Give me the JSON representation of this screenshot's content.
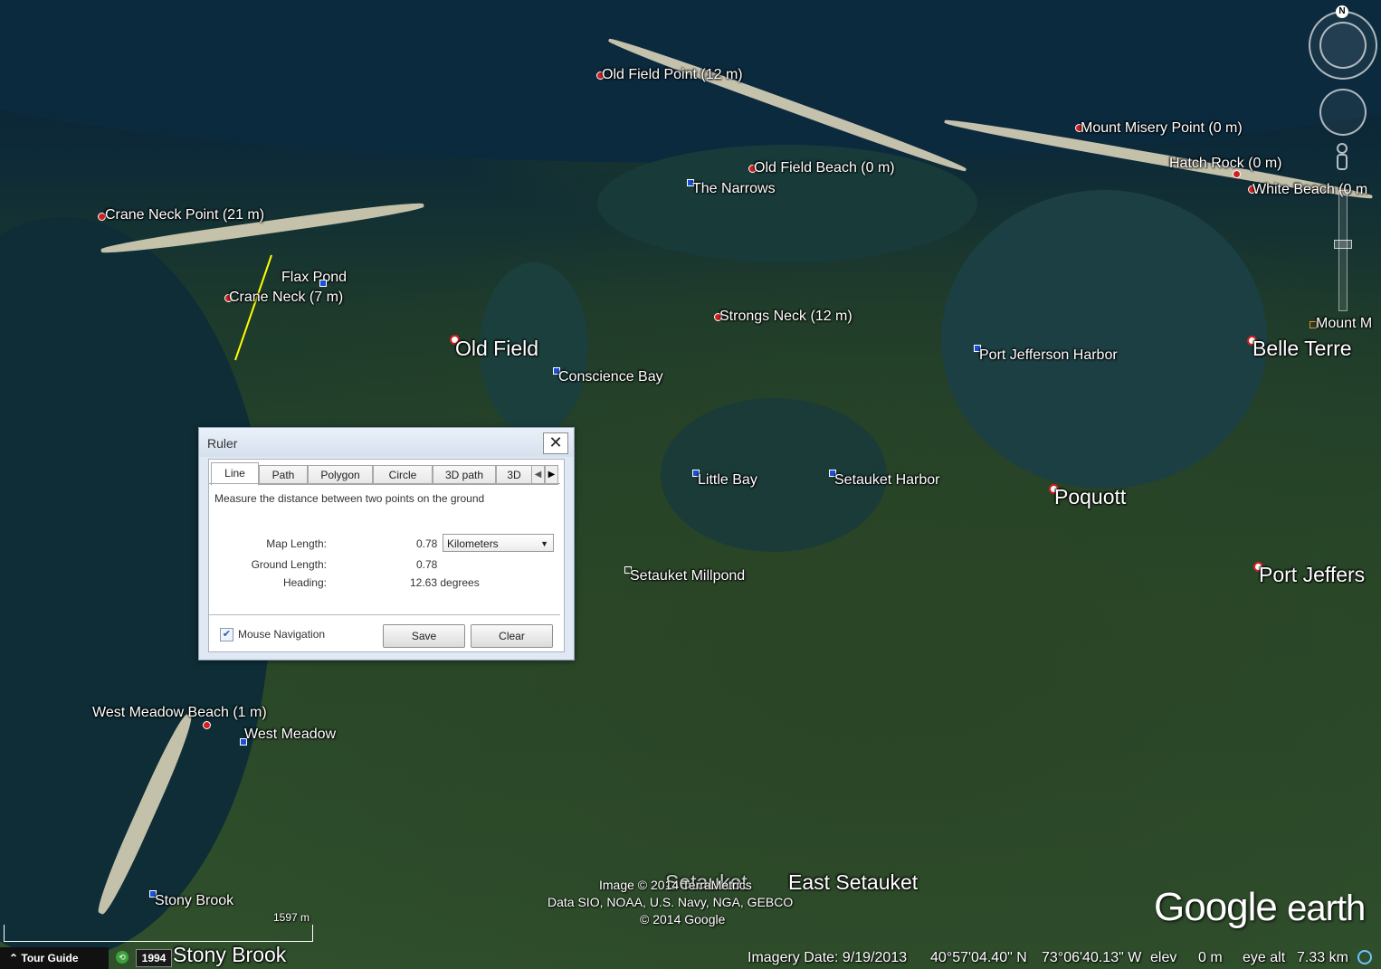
{
  "ruler": {
    "title": "Ruler",
    "close": "✕",
    "tabs": [
      "Line",
      "Path",
      "Polygon",
      "Circle",
      "3D path",
      "3D"
    ],
    "description": "Measure the distance between two points on the ground",
    "map_length_label": "Map Length:",
    "map_length_value": "0.78",
    "unit": "Kilometers",
    "ground_length_label": "Ground Length:",
    "ground_length_value": "0.78",
    "heading_label": "Heading:",
    "heading_value": "12.63 degrees",
    "mouse_nav_label": "Mouse Navigation",
    "mouse_nav_checked": true,
    "save_label": "Save",
    "clear_label": "Clear"
  },
  "places": {
    "old_field_point": "Old Field Point (12 m)",
    "mount_misery_point": "Mount Misery Point (0 m)",
    "hatch_rock": "Hatch Rock (0 m)",
    "white_beach": "White Beach (0 m",
    "old_field_beach": "Old Field Beach (0 m)",
    "the_narrows": "The Narrows",
    "crane_neck_point": "Crane Neck Point (21 m)",
    "flax_pond": "Flax Pond",
    "crane_neck": "Crane Neck (7 m)",
    "strongs_neck": "Strongs Neck (12 m)",
    "old_field": "Old Field",
    "conscience_bay": "Conscience Bay",
    "port_jefferson_harbor": "Port Jefferson Harbor",
    "mount_m": "Mount M",
    "belle_terre": "Belle Terre",
    "little_bay": "Little Bay",
    "setauket_harbor": "Setauket Harbor",
    "poquott": "Poquott",
    "port_jefferson": "Port Jeffers",
    "setauket_millpond": "Setauket Millpond",
    "west_meadow_beach": "West Meadow Beach (1 m)",
    "west_meadow": "West Meadow",
    "stony_brook_small": "Stony Brook",
    "stony_brook_large": "Stony Brook",
    "setauket": "Setauket",
    "east_setauket": "East Setauket"
  },
  "attribution": {
    "line1": "Image © 2014 TerraMetrics",
    "line2": "Data SIO, NOAA, U.S. Navy, NGA, GEBCO",
    "line3": "© 2014 Google"
  },
  "status": {
    "tour_guide": "Tour Guide",
    "year": "1994",
    "scale_label": "1597 m",
    "imagery_date": "Imagery Date: 9/19/2013",
    "lat": "40°57'04.40\" N",
    "lon": "73°06'40.13\" W",
    "elev_label": "elev",
    "elev_value": "0 m",
    "eye_alt_label": "eye alt",
    "eye_alt_value": "7.33 km"
  },
  "logo": {
    "google": "Google",
    "earth": "earth"
  },
  "nav": {
    "north": "N"
  },
  "icons": {
    "close": "close-icon",
    "checkbox": "checkbox-icon",
    "dropdown": "chevron-down-icon",
    "placemark": "placemark-icon",
    "compass": "compass-icon",
    "street_view": "pegman-icon"
  }
}
